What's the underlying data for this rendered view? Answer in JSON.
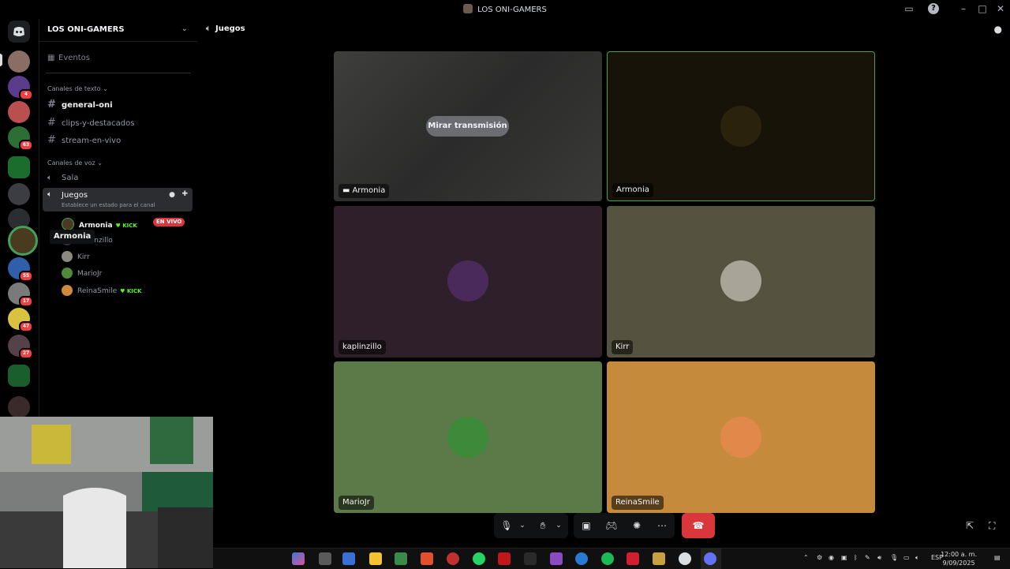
{
  "window": {
    "title": "LOS ONI-GAMERS"
  },
  "guild_badges": [
    "4",
    "63",
    "55",
    "17",
    "47",
    "27"
  ],
  "server": {
    "name": "LOS ONI-GAMERS"
  },
  "sidebar": {
    "events_label": "Eventos",
    "text_category": "Canales de texto",
    "text_channels": [
      "general-oni",
      "clips-y-destacados",
      "stream-en-vivo"
    ],
    "voice_category": "Canales de voz",
    "voice_channels": [
      "Sala",
      "Juegos"
    ],
    "voice_status": "Establece un estado para el canal",
    "live_badge": "EN VIVO",
    "voice_users": [
      {
        "name": "Armonia",
        "tag": "KICK"
      },
      {
        "name": "kaplinzillo",
        "tag": ""
      },
      {
        "name": "Kirr",
        "tag": ""
      },
      {
        "name": "MarioJr",
        "tag": ""
      },
      {
        "name": "ReinaSmile",
        "tag": "KICK"
      }
    ],
    "tooltip": "Armonia"
  },
  "main": {
    "channel_title": "Juegos",
    "watch_stream_label": "Mirar transmisión",
    "tiles": [
      "Armonia",
      "Armonia",
      "kaplinzillo",
      "Kirr",
      "MarioJr",
      "ReinaSmile"
    ]
  },
  "taskbar": {
    "lang": "ESP",
    "time": "12:00 a. m.",
    "date": "9/09/2025"
  },
  "colors": {
    "tile_purple": "#2f1f2a",
    "tile_olive": "#55533f",
    "tile_green": "#5c7a47",
    "tile_orange": "#c68a3d",
    "hangup": "#da373c",
    "speaking": "#43a25a"
  }
}
